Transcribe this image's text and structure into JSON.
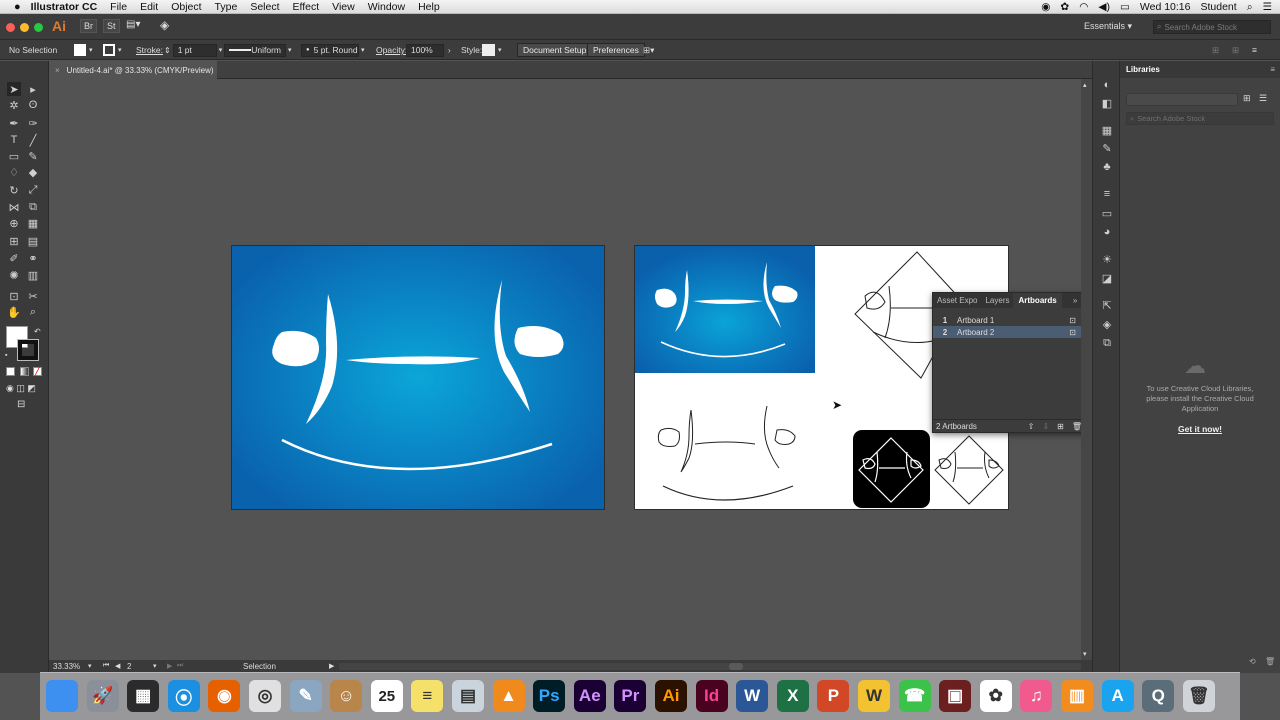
{
  "menubar": {
    "apple": "",
    "app_name": "Illustrator CC",
    "items": [
      "File",
      "Edit",
      "Object",
      "Type",
      "Select",
      "Effect",
      "View",
      "Window",
      "Help"
    ],
    "clock": "Wed 10:16",
    "user": "Student"
  },
  "appbar": {
    "ai_badge": "Ai",
    "br_badge": "Br",
    "st_badge": "St",
    "workspace": "Essentials",
    "search_placeholder": "Search Adobe Stock"
  },
  "control": {
    "selection": "No Selection",
    "stroke_label": "Stroke:",
    "stroke_value": "1 pt",
    "profile": "Uniform",
    "brush": "5 pt. Round",
    "opacity_label": "Opacity:",
    "opacity_value": "100%",
    "style_label": "Style:",
    "doc_setup": "Document Setup",
    "preferences": "Preferences"
  },
  "document": {
    "tab_title": "Untitled-4.ai* @ 33.33% (CMYK/Preview)",
    "close": "×"
  },
  "artboards_panel": {
    "tabs": [
      "Asset Expo",
      "Layers",
      "Artboards"
    ],
    "active_tab": "Artboards",
    "rows": [
      {
        "num": "1",
        "name": "Artboard 1"
      },
      {
        "num": "2",
        "name": "Artboard 2"
      }
    ],
    "footer": "2 Artboards"
  },
  "libraries": {
    "title": "Libraries",
    "search_placeholder": "Search Adobe Stock",
    "message": "To use Creative Cloud Libraries, please install the Creative Cloud Application",
    "link": "Get it now!"
  },
  "status": {
    "zoom": "33.33%",
    "page": "2",
    "tool": "Selection"
  },
  "dock": {
    "items": [
      {
        "name": "finder",
        "label": "",
        "color": "#3d8ff0"
      },
      {
        "name": "launchpad",
        "label": "🚀",
        "color": "#8a8f9a"
      },
      {
        "name": "photo-booth",
        "label": "▦",
        "color": "#2b2b2b"
      },
      {
        "name": "safari",
        "label": "⦿",
        "color": "#1b8fe0"
      },
      {
        "name": "firefox",
        "label": "◉",
        "color": "#e66000"
      },
      {
        "name": "chrome",
        "label": "◎",
        "color": "#e0e0e0"
      },
      {
        "name": "preview",
        "label": "✎",
        "color": "#8aa6c1"
      },
      {
        "name": "contacts",
        "label": "☺",
        "color": "#b8864b"
      },
      {
        "name": "calendar",
        "label": "25",
        "color": "#ffffff"
      },
      {
        "name": "notes",
        "label": "≡",
        "color": "#f5e16a"
      },
      {
        "name": "photos-preview",
        "label": "▤",
        "color": "#c9d4dc"
      },
      {
        "name": "vlc",
        "label": "▲",
        "color": "#f08a1c"
      },
      {
        "name": "photoshop",
        "label": "Ps",
        "color": "#001d26"
      },
      {
        "name": "after-effects",
        "label": "Ae",
        "color": "#1a0033"
      },
      {
        "name": "premiere",
        "label": "Pr",
        "color": "#1a0033"
      },
      {
        "name": "illustrator",
        "label": "Ai",
        "color": "#2b1100"
      },
      {
        "name": "indesign",
        "label": "Id",
        "color": "#49021f"
      },
      {
        "name": "word",
        "label": "W",
        "color": "#2b5797"
      },
      {
        "name": "excel",
        "label": "X",
        "color": "#1e7145"
      },
      {
        "name": "powerpoint",
        "label": "P",
        "color": "#d24726"
      },
      {
        "name": "fetch",
        "label": "W",
        "color": "#f2c230"
      },
      {
        "name": "facetime",
        "label": "☎",
        "color": "#3cc24b"
      },
      {
        "name": "photo-slideshow",
        "label": "▣",
        "color": "#6b1f1f"
      },
      {
        "name": "photos",
        "label": "✿",
        "color": "#ffffff"
      },
      {
        "name": "itunes",
        "label": "♫",
        "color": "#f05a8c"
      },
      {
        "name": "ibooks",
        "label": "▥",
        "color": "#f28c1e"
      },
      {
        "name": "app-store",
        "label": "A",
        "color": "#1aa4f0"
      },
      {
        "name": "quicktime",
        "label": "Q",
        "color": "#5c6d7a"
      },
      {
        "name": "trash",
        "label": "🗑",
        "color": "#d0d4d8"
      }
    ]
  },
  "colors": {
    "workspace_bg": "#535353",
    "panel_bg": "#3c3c3c",
    "artboard_blue": "#0a6db3",
    "artboard_blue_light": "#0ba4d6",
    "accent": "#2e6fbd"
  }
}
